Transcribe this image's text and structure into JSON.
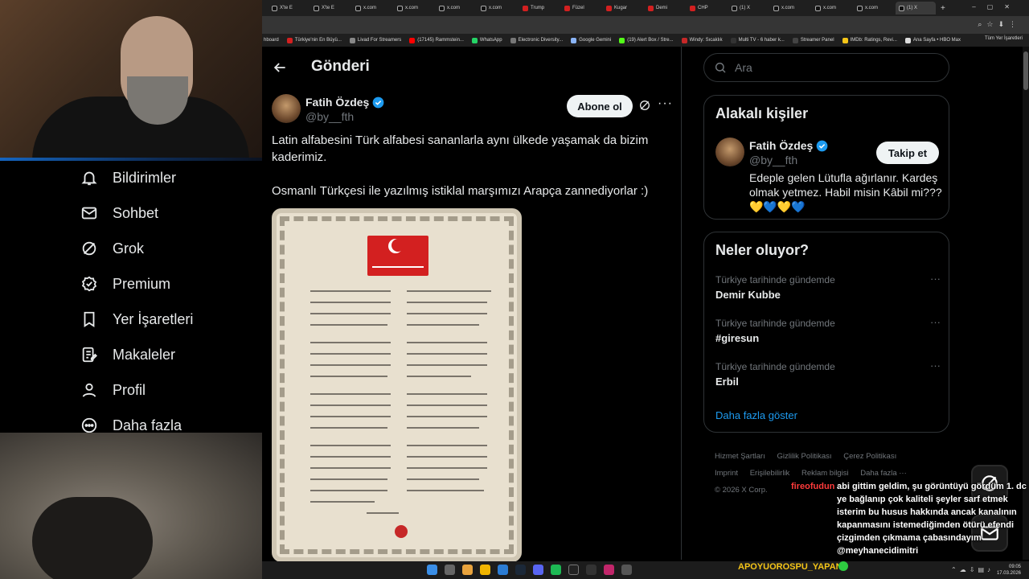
{
  "browser": {
    "tabs": [
      "X'te E",
      "X'te E",
      "x.com",
      "x.com",
      "x.com",
      "x.com",
      "Trump",
      "Füzel",
      "Kugar",
      "Demi",
      "CHP",
      "(1) X",
      "x.com",
      "x.com",
      "x.com",
      "(1) X"
    ],
    "bookmarks": [
      "hboard",
      "Türkiye'nin En Büyü...",
      "Livad For Streamers",
      "(17145) Rammstein...",
      "WhatsApp",
      "Electronic Diversity...",
      "Google Gemini",
      "(19) Alert Box / Stre...",
      "Windy: Sıcaklık",
      "Multi TV - 6 haber k...",
      "Streamer Panel",
      "IMDb: Ratings, Revi...",
      "Ana Sayfa • HBO Max"
    ],
    "bookmarks_right": "Tüm Yer İşaretleri"
  },
  "leftnav": {
    "items": [
      {
        "label": "Bildirimler",
        "icon": "bell-icon"
      },
      {
        "label": "Sohbet",
        "icon": "mail-icon"
      },
      {
        "label": "Grok",
        "icon": "grok-icon"
      },
      {
        "label": "Premium",
        "icon": "premium-icon"
      },
      {
        "label": "Yer İşaretleri",
        "icon": "bookmark-icon"
      },
      {
        "label": "Makaleler",
        "icon": "article-icon"
      },
      {
        "label": "Profil",
        "icon": "profile-icon"
      },
      {
        "label": "Daha fazla",
        "icon": "more-icon"
      }
    ]
  },
  "header": {
    "title": "Gönderi"
  },
  "post": {
    "name": "Fatih Özdeş",
    "handle": "@by__fth",
    "subscribe_label": "Abone ol",
    "text1": "Latin alfabesini Türk alfabesi sananlarla aynı ülkede yaşamak da bizim kaderimiz.",
    "text2": "Osmanlı Türkçesi ile yazılmış istiklal marşımızı Arapça zannediyorlar :)"
  },
  "search": {
    "placeholder": "Ara"
  },
  "related": {
    "title": "Alakalı kişiler",
    "name": "Fatih Özdeş",
    "handle": "@by__fth",
    "follow_label": "Takip et",
    "bio": "Edeple gelen Lütufla ağırlanır. Kardeş olmak yetmez. Habil misin Kâbil mi???",
    "bio_emoji": "💛💙💛💙"
  },
  "trends": {
    "title": "Neler oluyor?",
    "items": [
      {
        "meta": "Türkiye tarihinde gündemde",
        "name": "Demir Kubbe"
      },
      {
        "meta": "Türkiye tarihinde gündemde",
        "name": "#giresun"
      },
      {
        "meta": "Türkiye tarihinde gündemde",
        "name": "Erbil"
      }
    ],
    "show_more": "Daha fazla göster"
  },
  "footer": {
    "links": [
      "Hizmet Şartları",
      "Gizlilik Politikası",
      "Çerez Politikası",
      "Imprint",
      "Erişilebilirlik",
      "Reklam bilgisi",
      "Daha fazla ···"
    ],
    "copyright": "© 2026 X Corp."
  },
  "overlay": {
    "chat_user": "fireofudun",
    "chat_message": "abi gittim geldim, şu görüntüyü gördüm 1. dc ye bağlanıp çok kaliteli şeyler sarf etmek isterim bu husus hakkında ancak kanalının kapanmasını istemediğimden ötürü efendi çizgimden çıkmama çabasındayım @meyhanecidimitri",
    "ticker": "APOYUOROSPU_YAPAN"
  },
  "taskbar": {
    "time": "09:05",
    "date": "17.03.2026"
  },
  "colors": {
    "accent": "#1d9bf0",
    "verified": "#1d9bf0",
    "chat_user": "#ff3b3b",
    "ticker": "#f5c518"
  }
}
